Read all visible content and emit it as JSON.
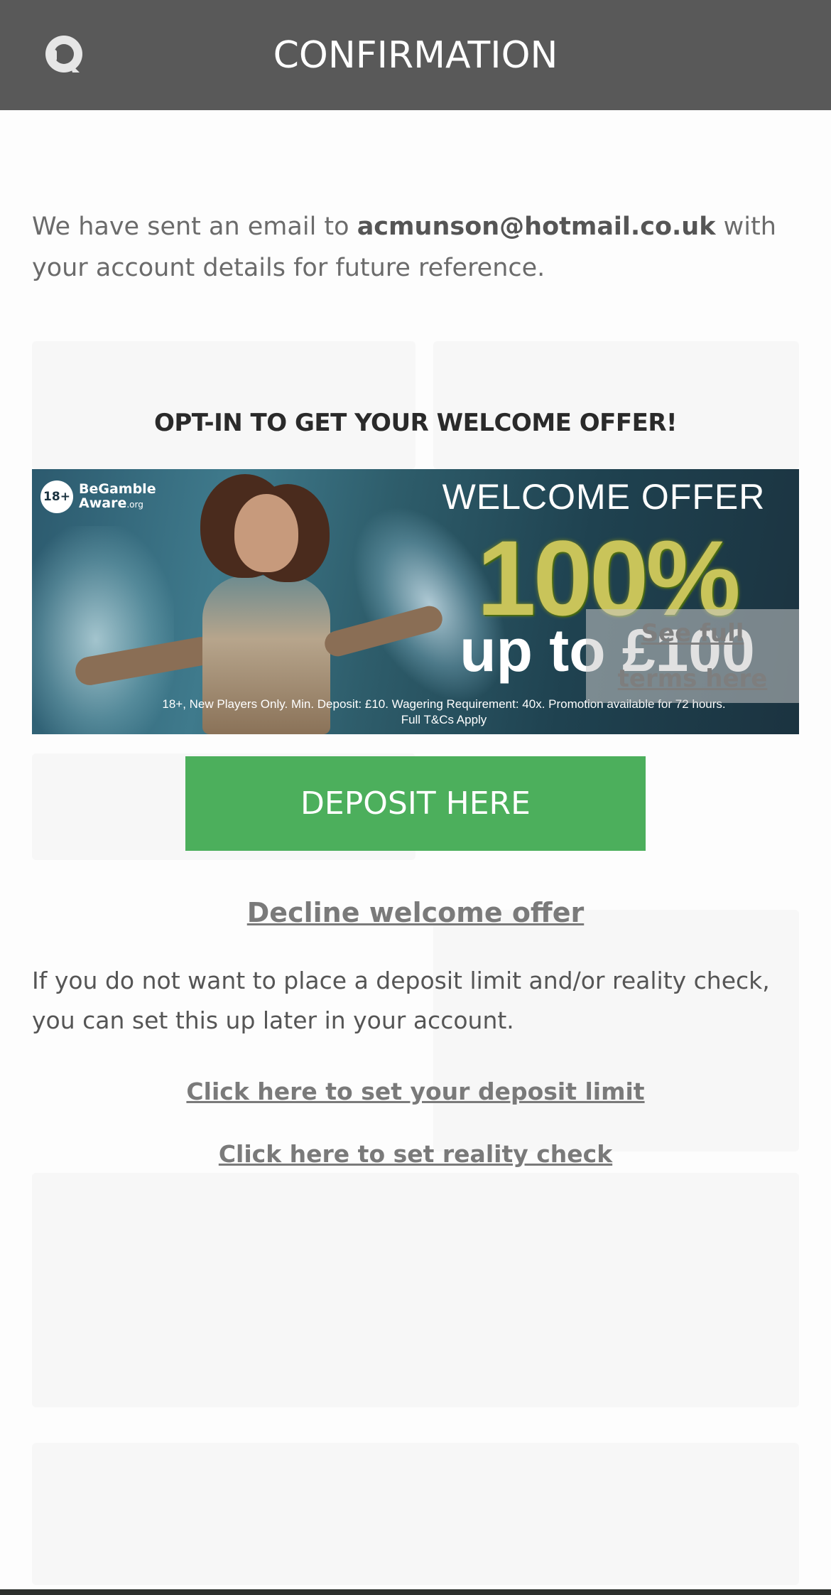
{
  "header": {
    "title": "CONFIRMATION",
    "support_icon": "chat-support-icon",
    "background_color": "#595959"
  },
  "intro": {
    "prefix": "We have sent an email to ",
    "email": "acmunson@hotmail.co.uk",
    "suffix": " with your account details for future reference."
  },
  "optin": {
    "title": "OPT-IN TO GET YOUR WELCOME OFFER!"
  },
  "banner": {
    "badge_age": "18+",
    "badge_brand": "BeGamble",
    "badge_brand_2": "Aware",
    "badge_domain": ".org",
    "heading": "WELCOME OFFER",
    "percent": "100%",
    "up_to": "up to £100",
    "small_print_1": "18+, New Players Only. Min. Deposit: £10. Wagering Requirement: 40x. Promotion available for 72 hours.",
    "small_print_2": "Full T&Cs Apply",
    "terms_link_line1": "See full",
    "terms_link_line2": "terms here"
  },
  "actions": {
    "deposit_button": "DEPOSIT HERE",
    "deposit_button_color": "#4caf5c",
    "decline_link": "Decline welcome offer"
  },
  "limits": {
    "text": "If you do not want to place a deposit limit and/or reality check, you can set this up later in your account.",
    "deposit_limit_link": "Click here to set your deposit limit",
    "reality_check_link": "Click here to set reality check"
  }
}
